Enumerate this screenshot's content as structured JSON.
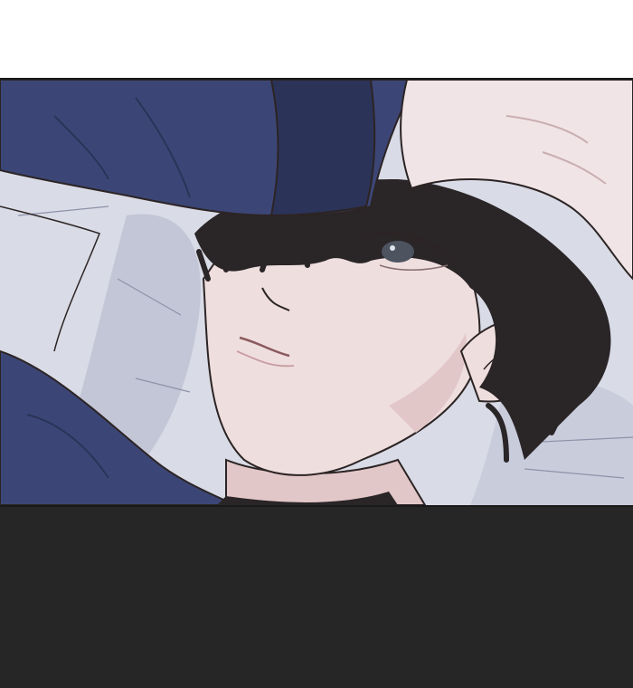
{
  "colors": {
    "page_background": "#ffffff",
    "bottom_area": "#262626",
    "panel_border": "#1a1a1a",
    "pillow": "#d9dbe6",
    "pillow_shadow": "#b9bccd",
    "sleeve": "#3c4676",
    "sleeve_dark": "#2b3358",
    "skin": "#efdede",
    "skin_shadow": "#e2c7c9",
    "hand_skin": "#f1e4e6",
    "hair": "#2a2527",
    "iris": "#4d5460",
    "line_art": "#2c2424"
  },
  "panel": {
    "description_icon": "comic-panel-sleeping-man-icon"
  }
}
